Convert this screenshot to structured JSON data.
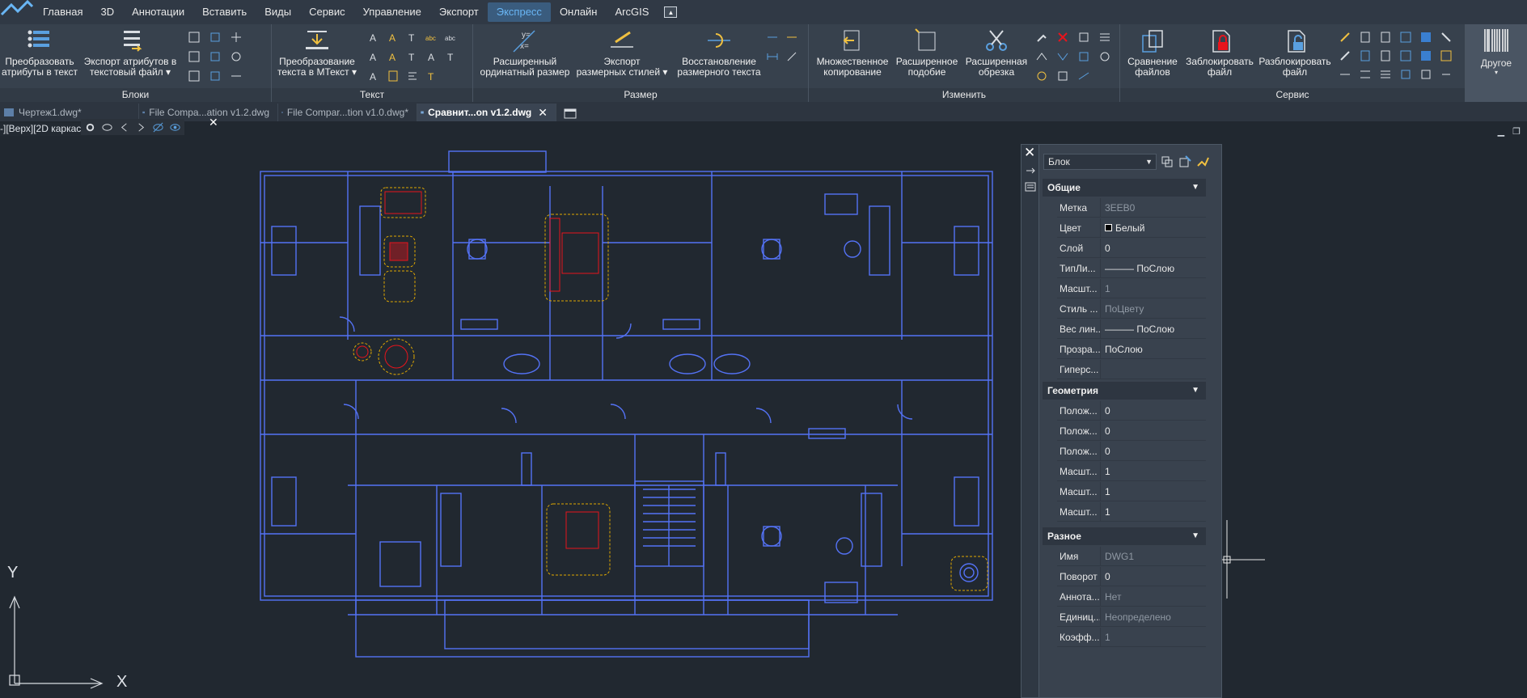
{
  "menu": {
    "items": [
      "Главная",
      "3D",
      "Аннотации",
      "Вставить",
      "Виды",
      "Сервис",
      "Управление",
      "Экспорт",
      "Экспресс",
      "Онлайн",
      "ArcGIS"
    ],
    "active": "Экспресс"
  },
  "ribbon": {
    "groups": {
      "blocks": "Блоки",
      "text": "Текст",
      "dimension": "Размер",
      "modify": "Изменить",
      "service": "Сервис"
    },
    "buttons": {
      "convert_attr": [
        "Преобразовать",
        "атрибуты в текст"
      ],
      "export_attr": [
        "Экспорт атрибутов в",
        "текстовый файл ▾"
      ],
      "convert_text": [
        "Преобразование",
        "текста в MТекст ▾"
      ],
      "ext_ordinate": [
        "Расширенный",
        "ординатный размер"
      ],
      "export_dimstyles": [
        "Экспорт",
        "размерных стилей ▾"
      ],
      "restore_dimtext": [
        "Восстановление",
        "размерного текста"
      ],
      "multi_copy": [
        "Множественное",
        "копирование"
      ],
      "ext_scale": [
        "Расширенное",
        "подобие"
      ],
      "ext_trim": [
        "Расширенная",
        "обрезка"
      ],
      "compare_files": [
        "Сравнение",
        "файлов"
      ],
      "lock_file": [
        "Заблокировать",
        "файл"
      ],
      "unlock_file": [
        "Разблокировать",
        "файл"
      ],
      "other": "Другое"
    }
  },
  "tabs": [
    {
      "label": "Чертеж1.dwg*",
      "active": false
    },
    {
      "label": "File Compa...ation v1.2.dwg",
      "active": false
    },
    {
      "label": "File Compar...tion v1.0.dwg*",
      "active": false
    },
    {
      "label": "Сравнит...on v1.2.dwg",
      "active": true
    }
  ],
  "viewport": {
    "label": "-][Верх][2D каркас"
  },
  "ucs": {
    "x": "X",
    "y": "Y"
  },
  "properties": {
    "selector": "Блок",
    "sections": [
      {
        "title": "Общие",
        "rows": [
          {
            "label": "Метка",
            "value": "3EEB0",
            "dim": true
          },
          {
            "label": "Цвет",
            "value": "Белый",
            "dim": false
          },
          {
            "label": "Слой",
            "value": "0",
            "dim": false
          },
          {
            "label": "ТипЛи...",
            "value": "——— ПоСлою",
            "dim": false
          },
          {
            "label": "Масшт...",
            "value": "1",
            "dim": true
          },
          {
            "label": "Стиль ...",
            "value": "ПоЦвету",
            "dim": true
          },
          {
            "label": "Вес лин...",
            "value": "——— ПоСлою",
            "dim": false
          },
          {
            "label": "Прозра...",
            "value": "ПоСлою",
            "dim": false
          },
          {
            "label": "Гиперс...",
            "value": "",
            "dim": false
          }
        ]
      },
      {
        "title": "Геометрия",
        "rows": [
          {
            "label": "Полож...",
            "value": "0",
            "dim": false
          },
          {
            "label": "Полож...",
            "value": "0",
            "dim": false
          },
          {
            "label": "Полож...",
            "value": "0",
            "dim": false
          },
          {
            "label": "Масшт...",
            "value": "1",
            "dim": false
          },
          {
            "label": "Масшт...",
            "value": "1",
            "dim": false
          },
          {
            "label": "Масшт...",
            "value": "1",
            "dim": false
          }
        ]
      },
      {
        "title": "Разное",
        "rows": [
          {
            "label": "Имя",
            "value": "DWG1",
            "dim": true
          },
          {
            "label": "Поворот",
            "value": "0",
            "dim": false
          },
          {
            "label": "Аннота...",
            "value": "Нет",
            "dim": true
          },
          {
            "label": "Единиц...",
            "value": "Неопределено",
            "dim": true
          },
          {
            "label": "Коэфф...",
            "value": "1",
            "dim": true
          }
        ]
      }
    ]
  },
  "colors": {
    "background": "#212830",
    "plan_lines": "#4f6fff",
    "diff_red": "#e8141c",
    "diff_yellow": "#e0a800",
    "accent": "#69b6f5"
  }
}
